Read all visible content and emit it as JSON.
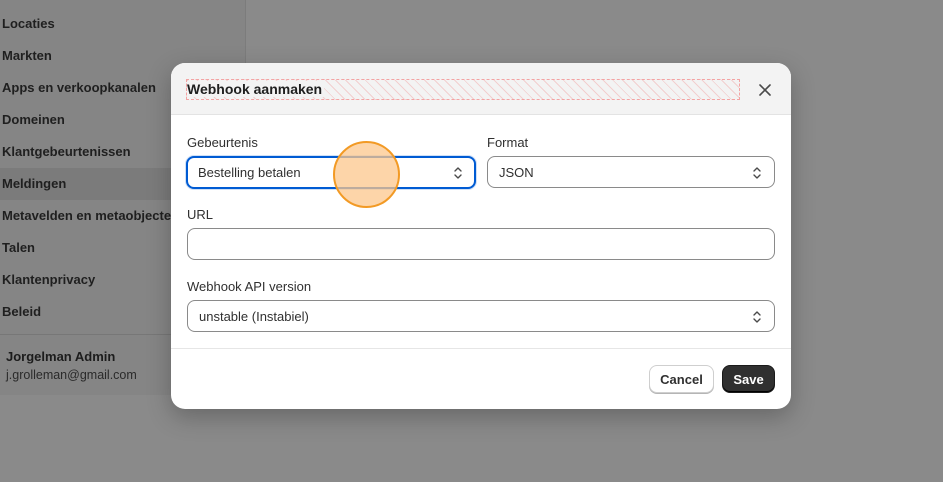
{
  "sidebar": {
    "items": [
      {
        "label": "Locaties"
      },
      {
        "label": "Markten"
      },
      {
        "label": "Apps en verkoopkanalen"
      },
      {
        "label": "Domeinen"
      },
      {
        "label": "Klantgebeurtenissen"
      },
      {
        "label": "Meldingen",
        "active": true
      },
      {
        "label": "Metavelden en metaobjecten"
      },
      {
        "label": "Talen"
      },
      {
        "label": "Klantenprivacy"
      },
      {
        "label": "Beleid"
      }
    ],
    "user": {
      "name": "Jorgelman Admin",
      "email": "j.grolleman@gmail.com"
    }
  },
  "modal": {
    "title": "Webhook aanmaken",
    "close_icon": "close-icon",
    "event": {
      "label": "Gebeurtenis",
      "value": "Bestelling betalen"
    },
    "format": {
      "label": "Format",
      "value": "JSON"
    },
    "url": {
      "label": "URL",
      "value": "",
      "placeholder": ""
    },
    "api_version": {
      "label": "Webhook API version",
      "value": "unstable (Instabiel)"
    },
    "cancel_label": "Cancel",
    "save_label": "Save"
  },
  "colors": {
    "focus_border": "#005bd3",
    "primary_button": "#303030",
    "cursor_highlight": "#f29a25"
  }
}
